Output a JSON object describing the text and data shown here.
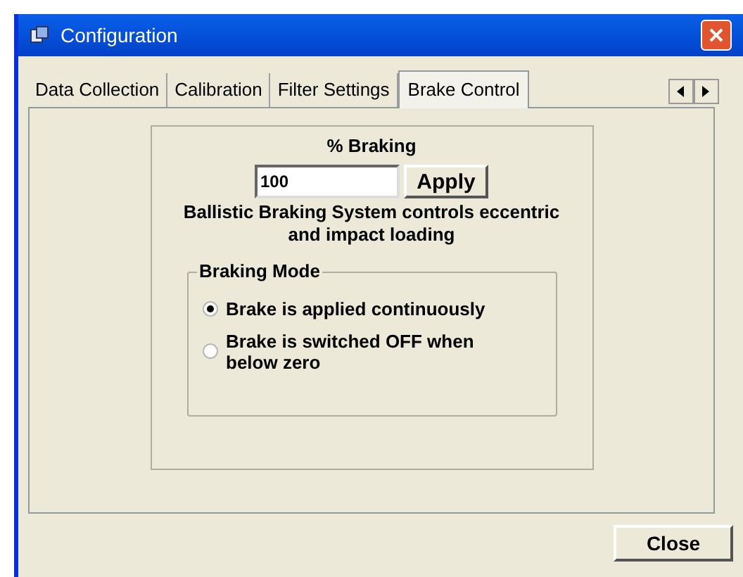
{
  "window": {
    "title": "Configuration"
  },
  "tabs": [
    {
      "label": "Data Collection",
      "selected": false
    },
    {
      "label": "Calibration",
      "selected": false
    },
    {
      "label": "Filter Settings",
      "selected": false
    },
    {
      "label": "Brake Control",
      "selected": true
    }
  ],
  "braking": {
    "label": "% Braking",
    "value": "100",
    "apply": "Apply",
    "description": "Ballistic Braking System controls eccentric and impact loading"
  },
  "mode_group": {
    "title": "Braking Mode",
    "options": [
      {
        "label": "Brake is applied continuously",
        "selected": true
      },
      {
        "label": "Brake is switched OFF when below zero",
        "selected": false
      }
    ]
  },
  "close_button": "Close"
}
